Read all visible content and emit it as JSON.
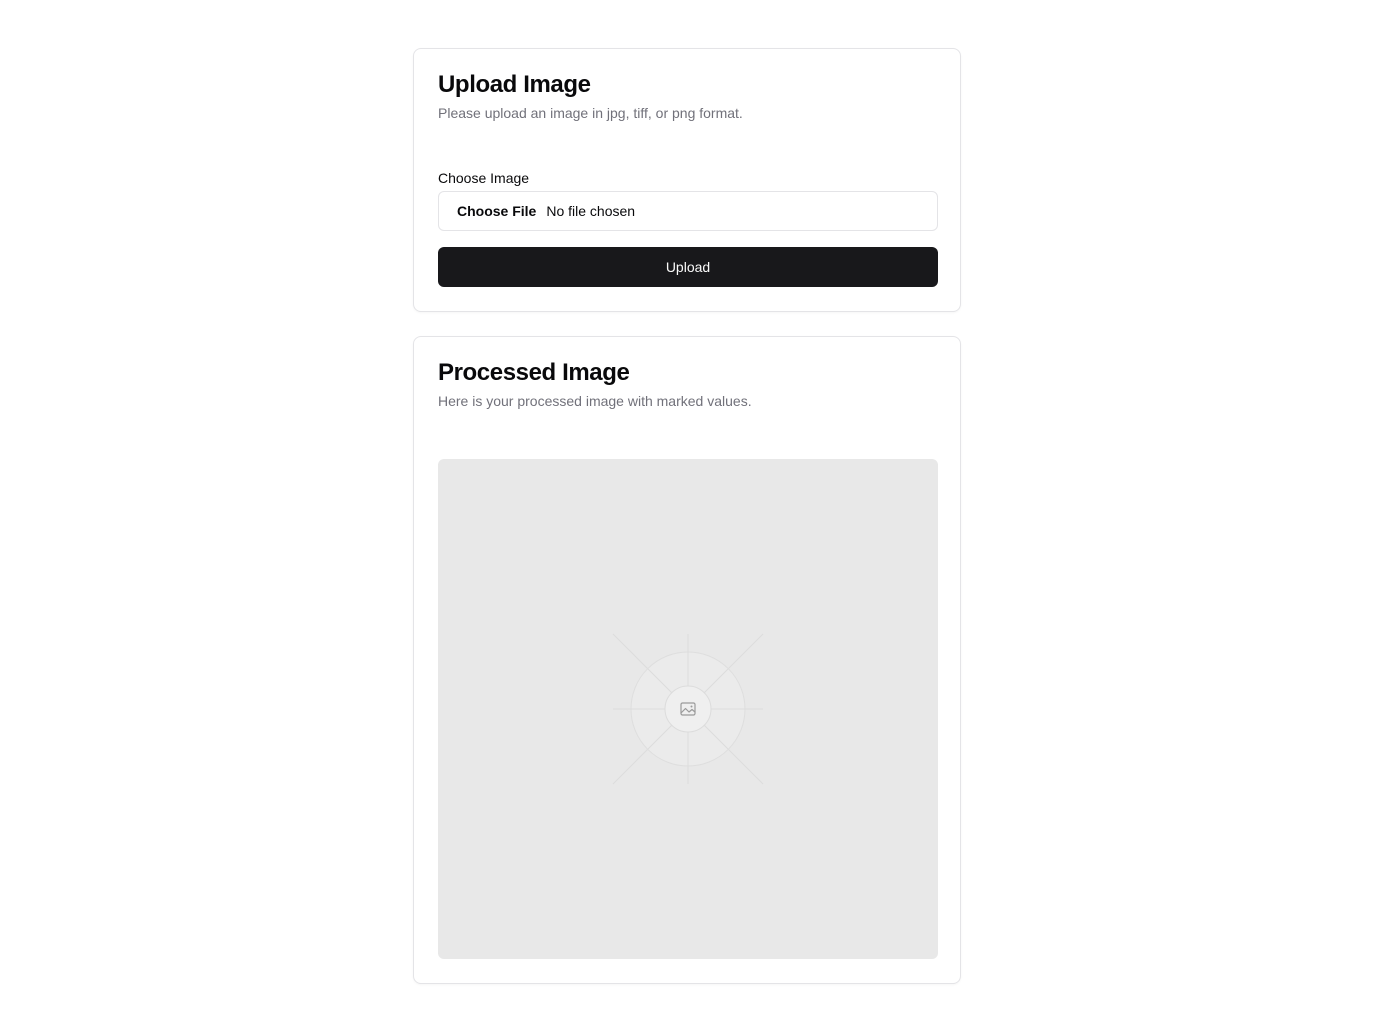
{
  "upload_card": {
    "title": "Upload Image",
    "description": "Please upload an image in jpg, tiff, or png format.",
    "field_label": "Choose Image",
    "file_button_label": "Choose File",
    "file_status": "No file chosen",
    "submit_label": "Upload"
  },
  "processed_card": {
    "title": "Processed Image",
    "description": "Here is your processed image with marked values.",
    "placeholder_icon": "image-icon"
  },
  "colors": {
    "primary_button": "#18181b",
    "muted_text": "#71717a",
    "border": "#e4e4e7",
    "placeholder_bg": "#e8e8e8"
  }
}
